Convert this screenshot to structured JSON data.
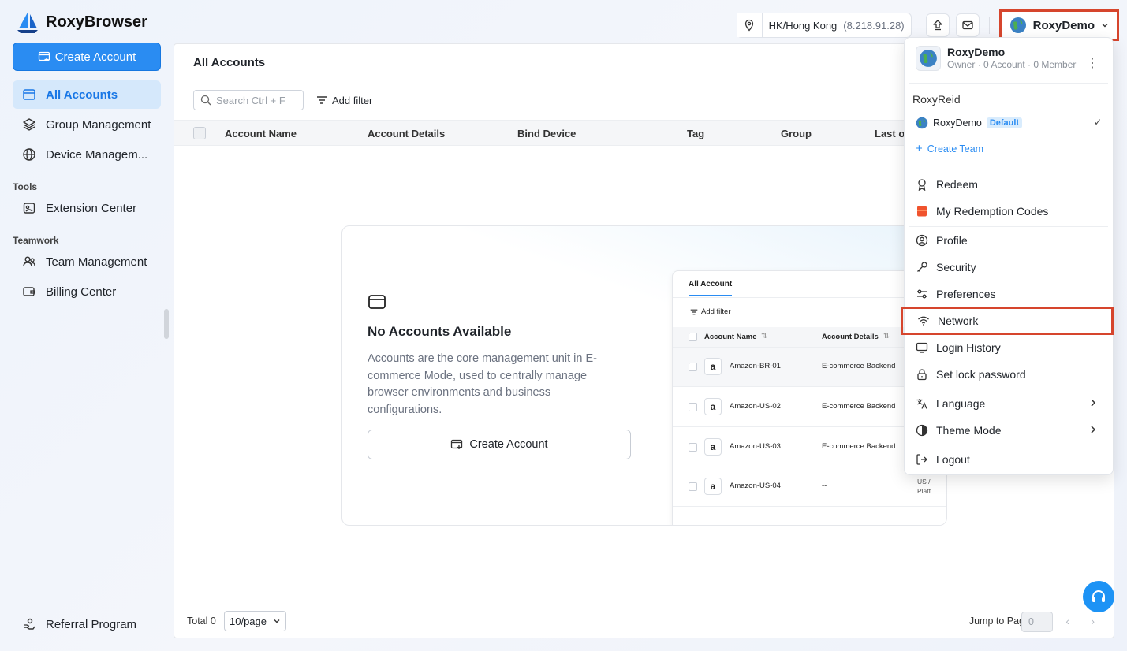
{
  "app": {
    "name": "RoxyBrowser"
  },
  "header": {
    "location": "HK/Hong Kong",
    "ip": "(8.218.91.28)",
    "user_name": "RoxyDemo"
  },
  "sidebar": {
    "create_label": "Create Account",
    "items": [
      {
        "label": "All Accounts",
        "icon": "card-icon"
      },
      {
        "label": "Group Management",
        "icon": "layers-icon"
      },
      {
        "label": "Device Managem...",
        "icon": "globe-icon"
      }
    ],
    "tools_label": "Tools",
    "tools_items": [
      {
        "label": "Extension Center",
        "icon": "extension-icon"
      }
    ],
    "teamwork_label": "Teamwork",
    "teamwork_items": [
      {
        "label": "Team Management",
        "icon": "team-icon"
      },
      {
        "label": "Billing Center",
        "icon": "wallet-icon"
      }
    ],
    "referral_label": "Referral Program"
  },
  "main": {
    "title": "All Accounts",
    "search_placeholder": "Search Ctrl + F",
    "add_filter": "Add filter",
    "columns": [
      "Account Name",
      "Account Details",
      "Bind Device",
      "Tag",
      "Group",
      "Last o"
    ],
    "empty": {
      "title": "No Accounts Available",
      "description": "Accounts are the core management unit in E-commerce Mode, used to centrally manage browser environments and business configurations.",
      "button": "Create Account"
    },
    "preview": {
      "tab": "All Account",
      "add_filter": "Add filter",
      "columns": [
        "Account Name",
        "Account Details"
      ],
      "rows": [
        {
          "name": "Amazon-BR-01",
          "details": "E-commerce Backend",
          "extra1": "",
          "extra2": ""
        },
        {
          "name": "Amazon-US-02",
          "details": "E-commerce Backend",
          "extra1": "",
          "extra2": ""
        },
        {
          "name": "Amazon-US-03",
          "details": "E-commerce Backend",
          "extra1": "",
          "extra2": ""
        },
        {
          "name": "Amazon-US-04",
          "details": "--",
          "extra1": "US /",
          "extra2": "Platf"
        }
      ],
      "logo_letter": "a"
    },
    "footer": {
      "total": "Total 0",
      "page_size": "10/page",
      "jump_label": "Jump to Page",
      "jump_value": "0"
    }
  },
  "dropdown": {
    "user_name": "RoxyDemo",
    "user_sub": "Owner · 0 Account · 0 Member",
    "team_label": "RoxyReid",
    "team_name": "RoxyDemo",
    "team_badge": "Default",
    "create_team": "Create Team",
    "items": {
      "redeem": "Redeem",
      "codes": "My Redemption Codes",
      "profile": "Profile",
      "security": "Security",
      "preferences": "Preferences",
      "network": "Network",
      "login_history": "Login History",
      "lock": "Set lock password",
      "language": "Language",
      "theme": "Theme Mode",
      "logout": "Logout"
    }
  },
  "colors": {
    "accent": "#2a8cf2",
    "highlight": "#d6452d",
    "active_bg": "#d5e8fb"
  }
}
